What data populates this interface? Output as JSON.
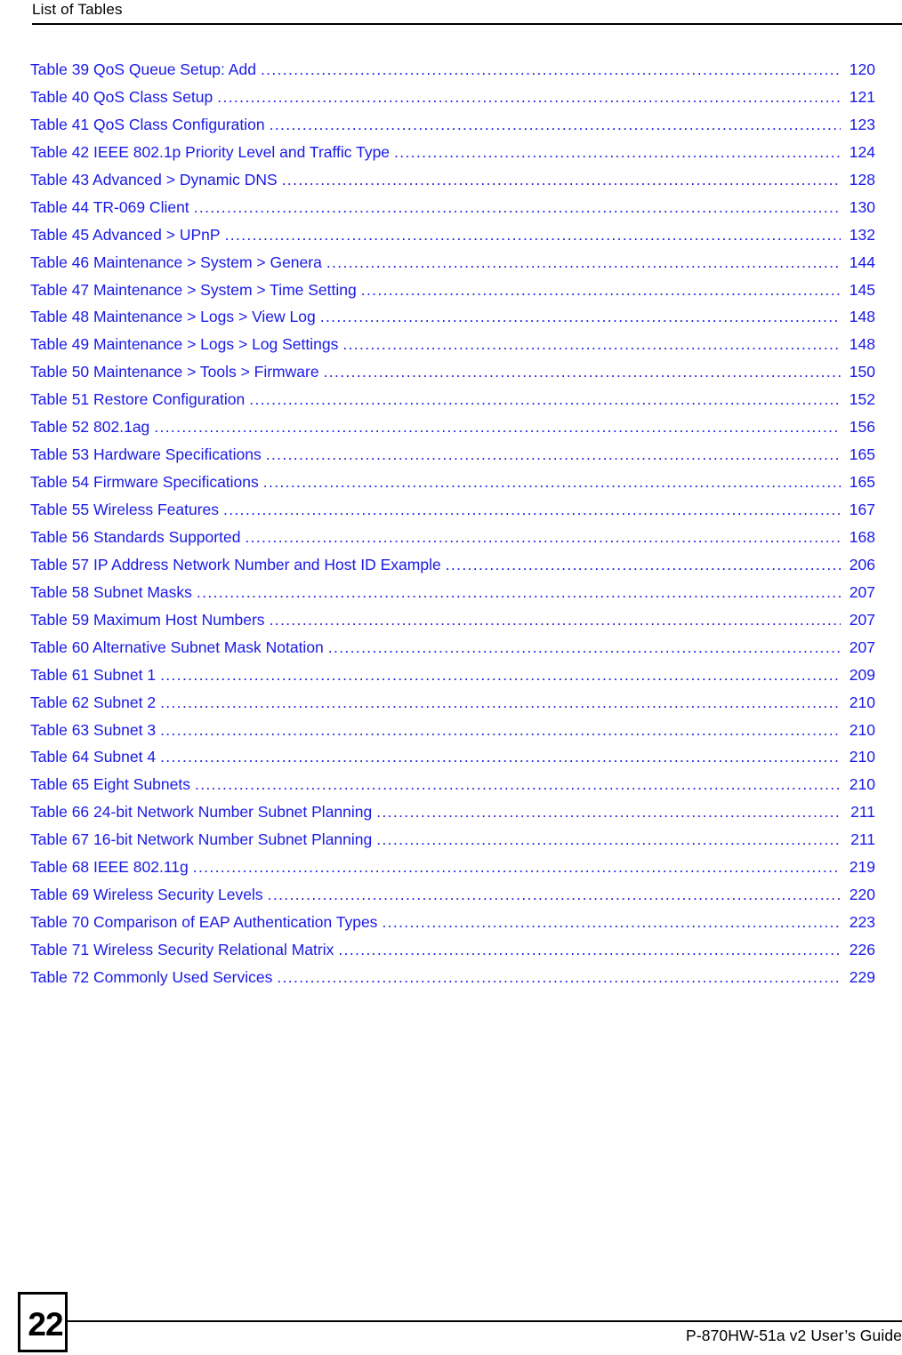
{
  "header": {
    "title": "List of Tables"
  },
  "toc": {
    "entries": [
      {
        "title": "Table 39 QoS Queue Setup: Add",
        "page": "120",
        "tight": false
      },
      {
        "title": "Table 40 QoS Class Setup",
        "page": "121",
        "tight": false
      },
      {
        "title": "Table 41 QoS Class Configuration",
        "page": "123",
        "tight": false
      },
      {
        "title": "Table 42 IEEE 802.1p Priority Level and Traffic Type",
        "page": "124",
        "tight": false
      },
      {
        "title": "Table 43 Advanced > Dynamic DNS",
        "page": "128",
        "tight": false
      },
      {
        "title": "Table 44 TR-069 Client",
        "page": "130",
        "tight": false
      },
      {
        "title": "Table 45 Advanced > UPnP",
        "page": "132",
        "tight": false
      },
      {
        "title": "Table 46 Maintenance > System > Genera",
        "page": "144",
        "tight": false
      },
      {
        "title": "Table 47 Maintenance > System > Time Setting",
        "page": "145",
        "tight": false
      },
      {
        "title": "Table 48 Maintenance > Logs > View Log",
        "page": "148",
        "tight": false
      },
      {
        "title": "Table 49 Maintenance > Logs > Log Settings",
        "page": "148",
        "tight": false
      },
      {
        "title": "Table 50 Maintenance > Tools > Firmware",
        "page": "150",
        "tight": false
      },
      {
        "title": "Table 51 Restore Configuration",
        "page": "152",
        "tight": false
      },
      {
        "title": "Table 52 802.1ag",
        "page": "156",
        "tight": false
      },
      {
        "title": "Table 53 Hardware Specifications",
        "page": "165",
        "tight": false
      },
      {
        "title": "Table 54 Firmware Specifications",
        "page": "165",
        "tight": false
      },
      {
        "title": "Table 55 Wireless Features",
        "page": "167",
        "tight": false
      },
      {
        "title": "Table 56 Standards Supported",
        "page": "168",
        "tight": false
      },
      {
        "title": "Table 57 IP Address Network Number and Host ID Example",
        "page": "206",
        "tight": false
      },
      {
        "title": "Table 58 Subnet Masks",
        "page": "207",
        "tight": false
      },
      {
        "title": "Table 59 Maximum Host Numbers",
        "page": "207",
        "tight": false
      },
      {
        "title": "Table 60 Alternative Subnet Mask Notation",
        "page": "207",
        "tight": false
      },
      {
        "title": "Table 61 Subnet 1",
        "page": "209",
        "tight": false
      },
      {
        "title": "Table 62 Subnet 2",
        "page": "210",
        "tight": false
      },
      {
        "title": "Table 63 Subnet 3",
        "page": "210",
        "tight": false
      },
      {
        "title": "Table 64 Subnet 4",
        "page": "210",
        "tight": false
      },
      {
        "title": "Table 65 Eight Subnets",
        "page": "210",
        "tight": false
      },
      {
        "title": "Table 66 24-bit Network Number Subnet Planning",
        "page": "211",
        "tight": true
      },
      {
        "title": "Table 67 16-bit Network Number Subnet Planning",
        "page": "211",
        "tight": true
      },
      {
        "title": "Table 68 IEEE 802.11g",
        "page": "219",
        "tight": false
      },
      {
        "title": "Table 69 Wireless Security Levels",
        "page": "220",
        "tight": false
      },
      {
        "title": "Table 70 Comparison of EAP Authentication Types",
        "page": "223",
        "tight": false
      },
      {
        "title": "Table 71 Wireless Security Relational Matrix",
        "page": "226",
        "tight": false
      },
      {
        "title": "Table 72 Commonly Used Services",
        "page": "229",
        "tight": false
      }
    ]
  },
  "footer": {
    "page_number": "22",
    "guide_title": "P-870HW-51a v2 User’s Guide"
  },
  "colors": {
    "link_blue": "#1a1ae6",
    "text_black": "#000000",
    "background": "#ffffff"
  }
}
